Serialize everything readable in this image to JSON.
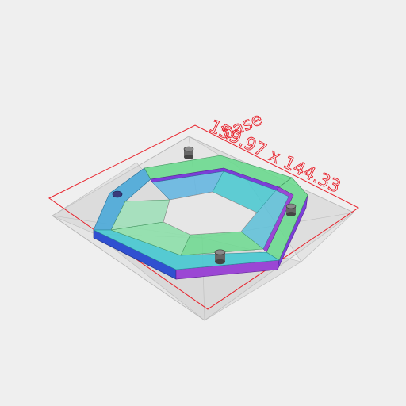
{
  "viewer": {
    "background_color": "#efefef"
  },
  "dimension": {
    "label": "base",
    "size_text": "159.97 x 144.33",
    "color": "#e8202a"
  },
  "model": {
    "ghost_color": "#d8d8d8",
    "edge_color": "#9a9a9a",
    "face_colors": {
      "blue": "#4aa8d8",
      "cyan": "#46c8d0",
      "green": "#6cd98f",
      "mint": "#8ae0a8",
      "violet": "#7a3fd8",
      "purple": "#9b47d4",
      "deep_blue": "#3050d0"
    },
    "pin_color": "#555555"
  }
}
